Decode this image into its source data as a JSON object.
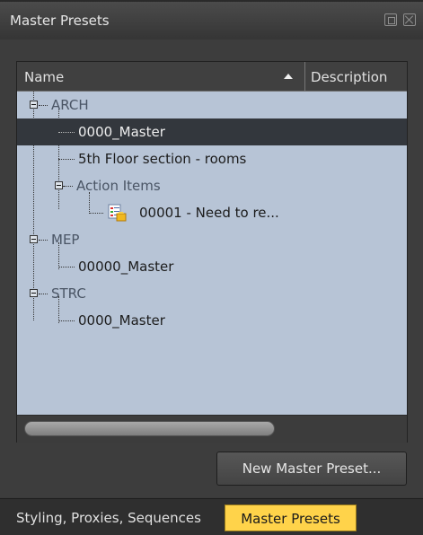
{
  "panel": {
    "title": "Master Presets"
  },
  "tree": {
    "columns": {
      "name": "Name",
      "description": "Description"
    },
    "rows": [
      {
        "label": "ARCH",
        "type": "group",
        "expanded": true
      },
      {
        "label": "0000_Master",
        "type": "preset",
        "selected": true
      },
      {
        "label": "5th Floor section - rooms",
        "type": "preset"
      },
      {
        "label": "Action Items",
        "type": "group",
        "expanded": true
      },
      {
        "label": "00001 - Need to re...",
        "type": "action-item",
        "icon": "task-checklist-icon"
      },
      {
        "label": "MEP",
        "type": "group",
        "expanded": true
      },
      {
        "label": "00000_Master",
        "type": "preset"
      },
      {
        "label": "STRC",
        "type": "group",
        "expanded": true
      },
      {
        "label": "0000_Master",
        "type": "preset"
      }
    ]
  },
  "buttons": {
    "new_preset": "New Master Preset..."
  },
  "tabs": [
    {
      "label": "Styling, Proxies, Sequences",
      "active": false
    },
    {
      "label": "Master Presets",
      "active": true
    }
  ],
  "colors": {
    "tree_bg": "#b7c4d6",
    "selected_row": "#33373d",
    "active_tab": "#ffd34a",
    "panel_bg": "#3d3d3d"
  }
}
